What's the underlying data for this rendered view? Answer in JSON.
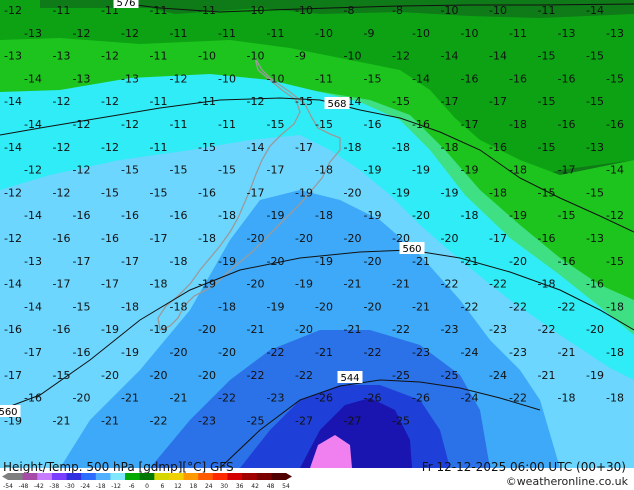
{
  "footer": {
    "title_left": "Height/Temp. 500 hPa [gdmp][°C] GFS",
    "title_right": "Fr 12-12-2025 06:00 UTC (00+30)",
    "credit": "©weatheronline.co.uk"
  },
  "colorbar": {
    "labels": [
      "-54",
      "-48",
      "-42",
      "-38",
      "-30",
      "-24",
      "-18",
      "-12",
      "-6",
      "0",
      "6",
      "12",
      "18",
      "24",
      "30",
      "36",
      "42",
      "48",
      "54"
    ],
    "colors": [
      "#7f7f7f",
      "#a64ca6",
      "#c77cff",
      "#7a3fff",
      "#3030e0",
      "#2a6dff",
      "#4fb0ff",
      "#7fe8ff",
      "#00aa00",
      "#007700",
      "#d6d600",
      "#f0d000",
      "#ff9900",
      "#ff5a00",
      "#ff2a00",
      "#d40000",
      "#a00000",
      "#7a0000",
      "#500000"
    ]
  },
  "height_labels": [
    "576",
    "568",
    "560",
    "560",
    "544"
  ],
  "temperature_labels": [
    "-12",
    "-11",
    "-11",
    "-11",
    "-11",
    "-10",
    "-10",
    "-8",
    "-8",
    "-10",
    "-10",
    "-11",
    "-14",
    "-13",
    "-12",
    "-12",
    "-11",
    "-11",
    "-11",
    "-10",
    "-9",
    "-10",
    "-10",
    "-11",
    "-13",
    "-13",
    "-13",
    "-13",
    "-12",
    "-11",
    "-10",
    "-10",
    "-9",
    "-10",
    "-12",
    "-14",
    "-14",
    "-15",
    "-15",
    "-14",
    "-13",
    "-13",
    "-12",
    "-10",
    "-10",
    "-11",
    "-15",
    "-14",
    "-16",
    "-16",
    "-16",
    "-15",
    "-14",
    "-12",
    "-12",
    "-11",
    "-11",
    "-12",
    "-15",
    "-14",
    "-15",
    "-17",
    "-17",
    "-15",
    "-15",
    "-14",
    "-12",
    "-12",
    "-11",
    "-11",
    "-15",
    "-15",
    "-16",
    "-16",
    "-17",
    "-18",
    "-16",
    "-16",
    "-14",
    "-12",
    "-12",
    "-11",
    "-15",
    "-14",
    "-17",
    "-18",
    "-18",
    "-18",
    "-16",
    "-15",
    "-13",
    "-12",
    "-12",
    "-15",
    "-15",
    "-15",
    "-17",
    "-18",
    "-19",
    "-19",
    "-19",
    "-18",
    "-17",
    "-14",
    "-12",
    "-12",
    "-15",
    "-15",
    "-16",
    "-17",
    "-19",
    "-20",
    "-19",
    "-19",
    "-18",
    "-15",
    "-15",
    "-14",
    "-16",
    "-16",
    "-16",
    "-18",
    "-19",
    "-18",
    "-19",
    "-20",
    "-18",
    "-19",
    "-15",
    "-12",
    "-12",
    "-16",
    "-16",
    "-17",
    "-18",
    "-20",
    "-20",
    "-20",
    "-20",
    "-20",
    "-17",
    "-16",
    "-13",
    "-13",
    "-17",
    "-17",
    "-18",
    "-19",
    "-20",
    "-19",
    "-20",
    "-21",
    "-21",
    "-20",
    "-16",
    "-15",
    "-14",
    "-17",
    "-17",
    "-18",
    "-19",
    "-20",
    "-19",
    "-21",
    "-21",
    "-22",
    "-22",
    "-18",
    "-16",
    "-14",
    "-15",
    "-18",
    "-18",
    "-18",
    "-19",
    "-20",
    "-20",
    "-21",
    "-22",
    "-22",
    "-22",
    "-18",
    "-16",
    "-16",
    "-19",
    "-19",
    "-20",
    "-21",
    "-20",
    "-21",
    "-22",
    "-23",
    "-23",
    "-22",
    "-20",
    "-17",
    "-16",
    "-19",
    "-20",
    "-20",
    "-22",
    "-21",
    "-22",
    "-23",
    "-24",
    "-23",
    "-21",
    "-18",
    "-17",
    "-15",
    "-20",
    "-20",
    "-20",
    "-22",
    "-22",
    "-23",
    "-25",
    "-25",
    "-24",
    "-21",
    "-19",
    "-16",
    "-20",
    "-21",
    "-21",
    "-22",
    "-23",
    "-26",
    "-26",
    "-26",
    "-24",
    "-22",
    "-18",
    "-18",
    "-19",
    "-21",
    "-21",
    "-22",
    "-23",
    "-25",
    "-27",
    "-27",
    "-25"
  ]
}
